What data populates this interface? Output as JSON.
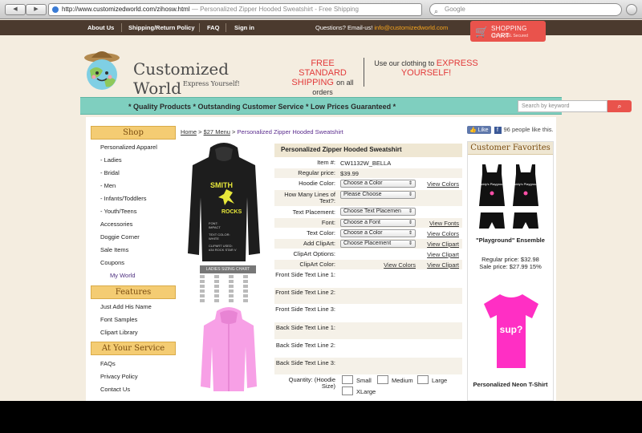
{
  "browser": {
    "url": "http://www.customizedworld.com/zihosw.html",
    "page_title": "— Personalized Zipper Hooded Sweatshirt - Free Shipping",
    "search_placeholder": "Google",
    "back_label": "◀",
    "forward_label": "▶"
  },
  "topbar": {
    "links": [
      "About Us",
      "Shipping/Return Policy",
      "FAQ",
      "Sign in"
    ],
    "questions": "Questions? Email-us!",
    "email": "info@customizedworld.com",
    "cart_label": "SHOPPING CART",
    "cart_sub": "128-bit SSL Secured"
  },
  "header": {
    "brand": "Customized World",
    "tagline": "Express Yourself!",
    "promo1_red": "FREE STANDARD SHIPPING",
    "promo1_dark": "on all orders",
    "promo2_dark": "Use our clothing to",
    "promo2_red": "EXPRESS YOURSELF!"
  },
  "banner": {
    "guarantee": "* Quality Products * Outstanding Customer Service * Low Prices Guaranteed *",
    "search_placeholder": "Search by keyword"
  },
  "sidebar": {
    "shop_title": "Shop",
    "shop_items": [
      "Personalized Apparel",
      "- Ladies",
      "- Bridal",
      "- Men",
      "- Infants/Toddlers",
      "- Youth/Teens",
      "Accessories",
      "Doggie Corner",
      "Sale Items",
      "Coupons"
    ],
    "my_world": "My World",
    "features_title": "Features",
    "features_items": [
      "Just Add His Name",
      "Font Samples",
      "Clipart Library"
    ],
    "service_title": "At Your Service",
    "service_items": [
      "FAQs",
      "Privacy Policy",
      "Contact Us"
    ]
  },
  "breadcrumb": {
    "home": "Home",
    "sep": ">",
    "menu": "$27 Menu",
    "current": "Personalized Zipper Hooded Sweatshirt"
  },
  "facebook": {
    "like": "Like",
    "count_text": "96 people like this."
  },
  "product": {
    "title": "Personalized Zipper Hooded Sweatshirt",
    "sizing_chart": "LADIES SIZING CHART",
    "hoodie_text1": "SMITH",
    "hoodie_text2": "ROCKS",
    "hoodie_notes": [
      "FONT:",
      "IMPACT",
      "TEXT COLOR:",
      "WHITE",
      "CLIPART USED:",
      "#34 ROCK STAR V"
    ],
    "rows": [
      {
        "label": "Item #:",
        "value": "CW1132W_BELLA"
      },
      {
        "label": "Regular price:",
        "value": "$39.99"
      },
      {
        "label": "Hoodie Color:",
        "select": "Choose a Color",
        "link": "View Colors"
      },
      {
        "label": "How Many Lines of Text?:",
        "select": "Please Choose"
      },
      {
        "label": "Text Placement:",
        "select": "Choose Text Placemen"
      },
      {
        "label": "Font:",
        "select": "Choose a Font",
        "link": "View Fonts"
      },
      {
        "label": "Text Color:",
        "select": "Choose a Color",
        "link": "View Colors"
      },
      {
        "label": "Add ClipArt:",
        "select": "Choose Placement",
        "link": "View Clipart"
      },
      {
        "label": "ClipArt Options:",
        "link": "View Clipart"
      },
      {
        "label": "ClipArt Color:",
        "link": "View Colors",
        "link2": "View Clipart"
      },
      {
        "label": "Front Side Text Line 1:"
      },
      {
        "label": "Front Side Text Line 2:"
      },
      {
        "label": "Front Side Text Line 3:"
      },
      {
        "label": "Back Side Text Line 1:"
      },
      {
        "label": "Back Side Text Line 2:"
      },
      {
        "label": "Back Side Text Line 3:"
      }
    ],
    "quantity_label": "Quantity: (Hoodie Size)",
    "sizes": [
      "Small",
      "Medium",
      "Large",
      "XLarge"
    ]
  },
  "favorites": {
    "title": "Customer Favorites",
    "item1_name": "\"Playground\" Ensemble",
    "item1_regular": "Regular price: $32.98",
    "item1_sale": "Sale price: $27.99 15%",
    "item1_shirt_text": "Daddy's Playground",
    "item2_name": "Personalized Neon T-Shirt",
    "item2_text": "sup?"
  },
  "colors": {
    "topbar": "#4b3a2e",
    "teal": "#7fcfbf",
    "cart": "#e9534c",
    "red_text": "#e23a3a",
    "sidebar_head": "#f4cc73"
  }
}
